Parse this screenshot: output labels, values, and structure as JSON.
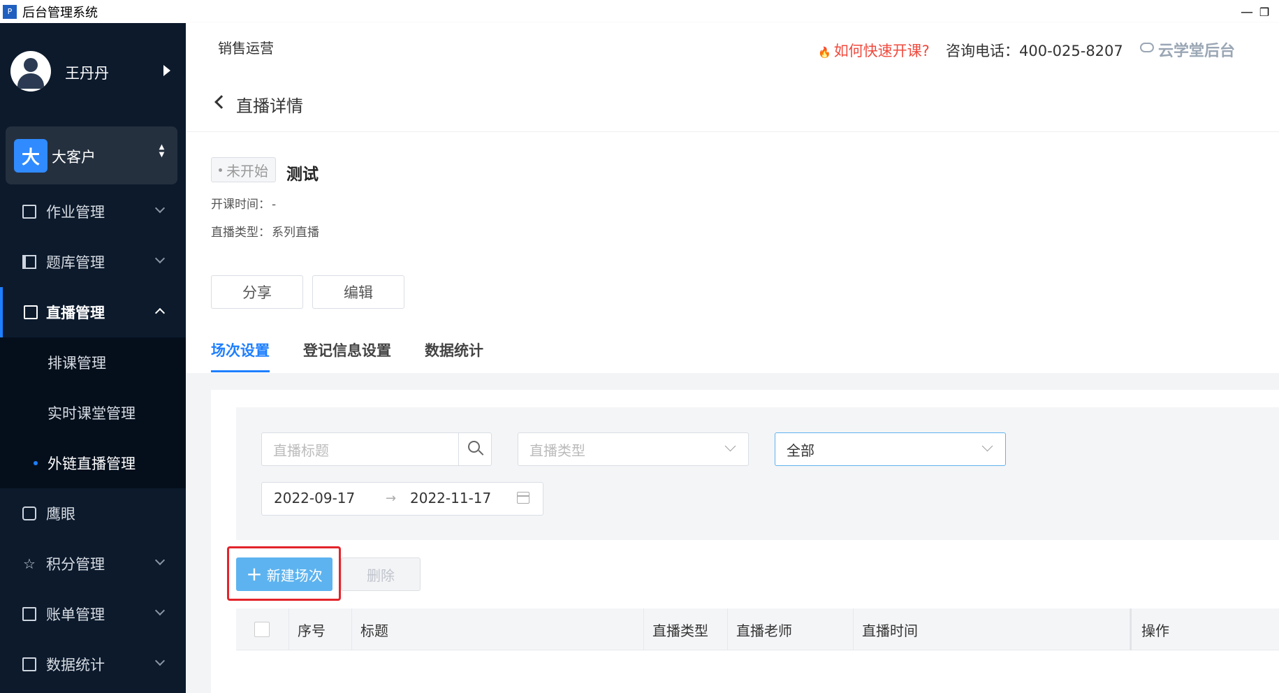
{
  "window": {
    "app_icon_letter": "P",
    "title": "后台管理系统",
    "minimize_glyph": "—",
    "restore_glyph": "❐"
  },
  "sidebar": {
    "user_name": "王丹丹",
    "org": {
      "badge": "大",
      "name": "大客户",
      "updown_glyph": "▲▼"
    },
    "items": [
      {
        "label": "作业管理",
        "icon": "clipboard-icon"
      },
      {
        "label": "题库管理",
        "icon": "book-icon"
      },
      {
        "label": "直播管理",
        "icon": "tv-icon",
        "expanded": true
      },
      {
        "label": "鹰眼",
        "icon": "eye-icon"
      },
      {
        "label": "积分管理",
        "icon": "star-icon",
        "glyph": "☆"
      },
      {
        "label": "账单管理",
        "icon": "bill-icon"
      },
      {
        "label": "数据统计",
        "icon": "chart-icon"
      }
    ],
    "subitems": [
      {
        "label": "排课管理"
      },
      {
        "label": "实时课堂管理"
      },
      {
        "label": "外链直播管理",
        "active": true
      }
    ]
  },
  "header": {
    "section": "销售运营",
    "help_text": "如何快速开课?",
    "help_icon_glyph": "🔥",
    "phone_text": "咨询电话：400-025-8207",
    "brand": "云学堂后台"
  },
  "page": {
    "title": "直播详情",
    "status": "未开始",
    "live_title": "测试",
    "start_time_label": "开课时间：",
    "start_time_value": "-",
    "live_type_label": "直播类型：",
    "live_type_value": "系列直播",
    "share_label": "分享",
    "edit_label": "编辑"
  },
  "tabs": [
    {
      "label": "场次设置",
      "active": true
    },
    {
      "label": "登记信息设置"
    },
    {
      "label": "数据统计"
    }
  ],
  "filters": {
    "title_placeholder": "直播标题",
    "type_placeholder": "直播类型",
    "status_value": "全部",
    "date_start": "2022-09-17",
    "date_end": "2022-11-17",
    "date_arrow": "→"
  },
  "actions": {
    "new_session_label": "新建场次",
    "plus_glyph": "+",
    "delete_label": "删除"
  },
  "table": {
    "columns": [
      "序号",
      "标题",
      "直播类型",
      "直播老师",
      "直播时间",
      "操作"
    ]
  },
  "colors": {
    "sidebar_bg": "#0c1a2c",
    "accent": "#1e7fff",
    "primary_button": "#5db3ef",
    "alert_red": "#f04a3e",
    "highlight_box": "#e3242b"
  }
}
